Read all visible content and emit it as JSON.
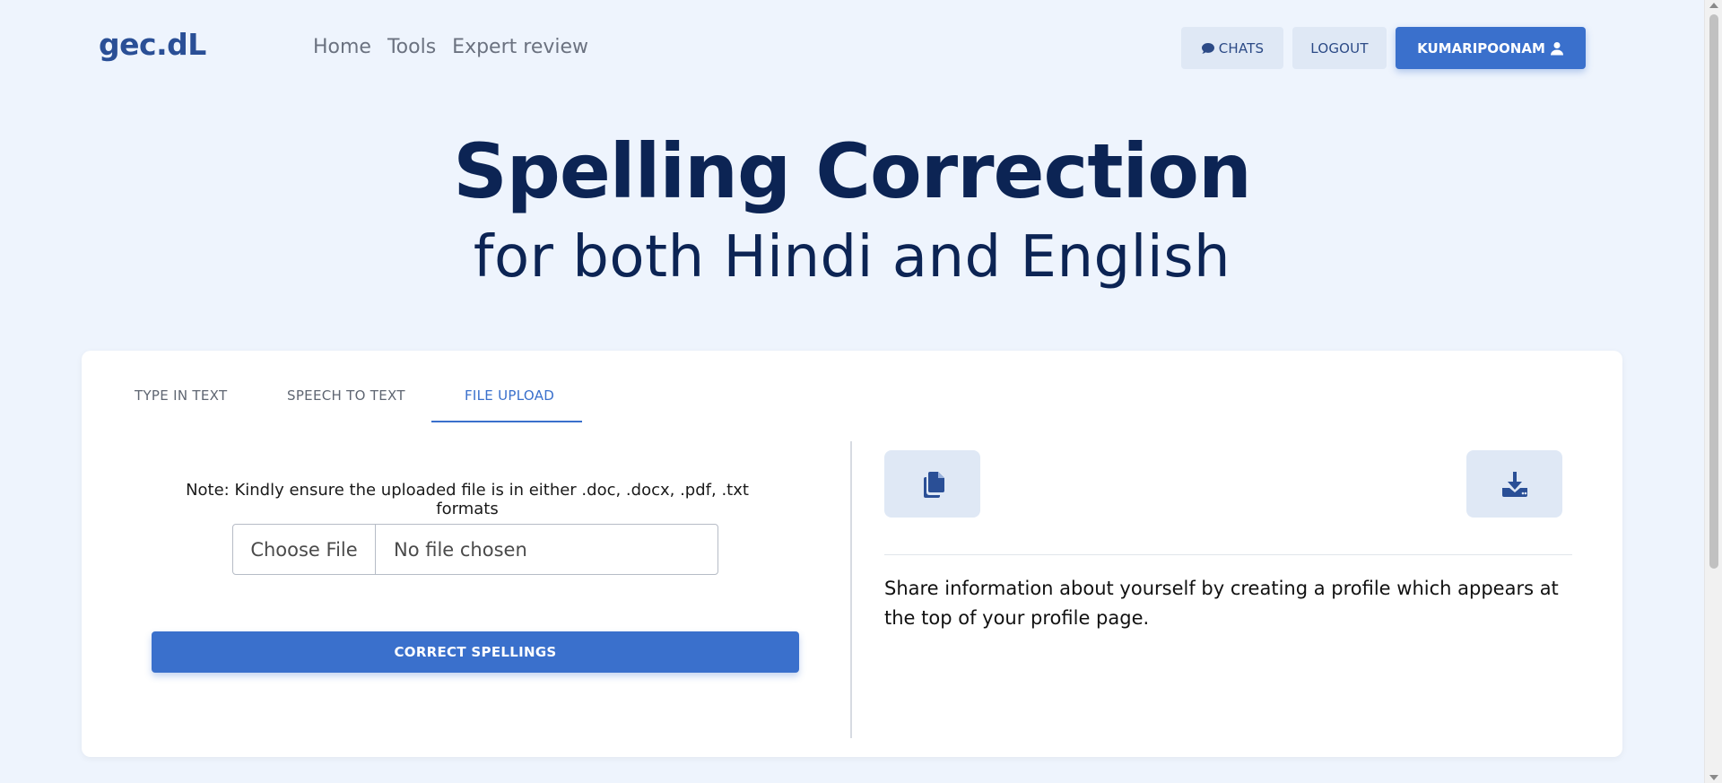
{
  "header": {
    "brand": "gec.dL",
    "nav": [
      "Home",
      "Tools",
      "Expert review"
    ],
    "chats_label": "CHATS",
    "logout_label": "LOGOUT",
    "user_label": "KUMARIPOONAM",
    "chats_icon": "comment-icon",
    "user_icon": "user-icon"
  },
  "hero": {
    "title": "Spelling Correction",
    "subtitle": "for both Hindi and English"
  },
  "tabs": {
    "items": [
      "TYPE IN TEXT",
      "SPEECH TO TEXT",
      "FILE UPLOAD"
    ],
    "active": "FILE UPLOAD"
  },
  "upload": {
    "note": "Note: Kindly ensure the uploaded file is in either .doc, .docx, .pdf, .txt formats",
    "choose_label": "Choose File",
    "status": "No file chosen",
    "submit_label": "CORRECT SPELLINGS"
  },
  "output": {
    "copy_icon": "copy-icon",
    "download_icon": "download-icon",
    "text": "Share information about yourself by creating a profile which appears at the top of your profile page."
  },
  "colors": {
    "accent": "#3a70cc",
    "background": "#eef4fd",
    "heading": "#0c2454",
    "light_button": "#dfe8f5"
  }
}
